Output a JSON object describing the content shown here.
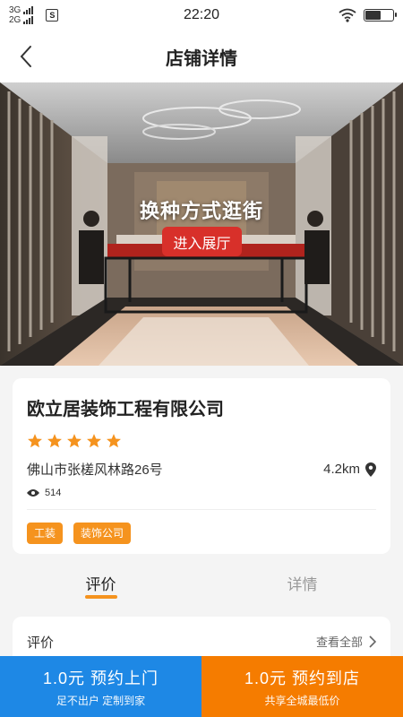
{
  "status_bar": {
    "network_1": "3G",
    "network_2": "2G",
    "sim_label": "S",
    "time": "22:20"
  },
  "header": {
    "title": "店铺详情"
  },
  "hero": {
    "overlay_title": "换种方式逛街",
    "button_label": "进入展厅"
  },
  "store": {
    "name": "欧立居装饰工程有限公司",
    "rating": 5,
    "address": "佛山市张槎风林路26号",
    "distance": "4.2km",
    "views": "514",
    "tags": [
      "工装",
      "装饰公司"
    ]
  },
  "tabs": [
    {
      "label": "评价",
      "active": true
    },
    {
      "label": "详情",
      "active": false
    }
  ],
  "review": {
    "title": "评价",
    "see_all": "查看全部"
  },
  "cta": {
    "left": {
      "main": "1.0元  预约上门",
      "sub": "足不出户 定制到家"
    },
    "right": {
      "main": "1.0元  预约到店",
      "sub": "共享全城最低价"
    }
  },
  "colors": {
    "accent_orange": "#f5931e",
    "hero_button": "#d8302a",
    "cta_left": "#1e88e5",
    "cta_right": "#f57c00"
  }
}
